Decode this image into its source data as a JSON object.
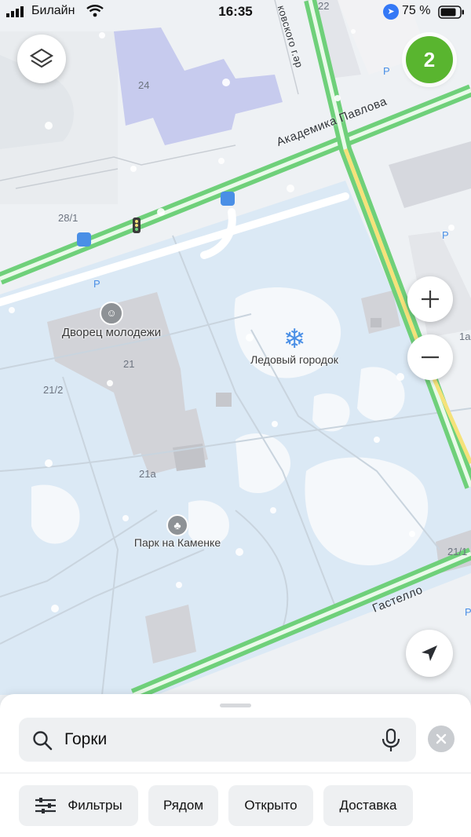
{
  "status_bar": {
    "carrier": "Билайн",
    "time": "16:35",
    "battery": "75 %"
  },
  "map": {
    "streets": {
      "pavlova": "Академика Павлова",
      "gastello": "Гастелло",
      "top_partial": "ковского г.әр"
    },
    "poi": {
      "palace": "Дворец молодежи",
      "ice_town": "Ледовый городок",
      "park": "Парк на Каменке"
    },
    "houses": {
      "h24": "24",
      "h22": "22",
      "h28_1": "28/1",
      "h21": "21",
      "h21_2": "21/2",
      "h21a": "21а",
      "h21_1": "21/1",
      "h1a": "1а"
    },
    "parking_letter": "P"
  },
  "controls": {
    "results_count": "2"
  },
  "search": {
    "query": "Горки"
  },
  "filters": {
    "filters_label": "Фильтры",
    "nearby_label": "Рядом",
    "open_label": "Открыто",
    "delivery_label": "Доставка"
  },
  "colors": {
    "accent_green": "#59b52f",
    "road_green": "#6fd07a",
    "road_yellow": "#f5e27a",
    "park": "#d7e8f5",
    "building": "#d4d5da"
  }
}
